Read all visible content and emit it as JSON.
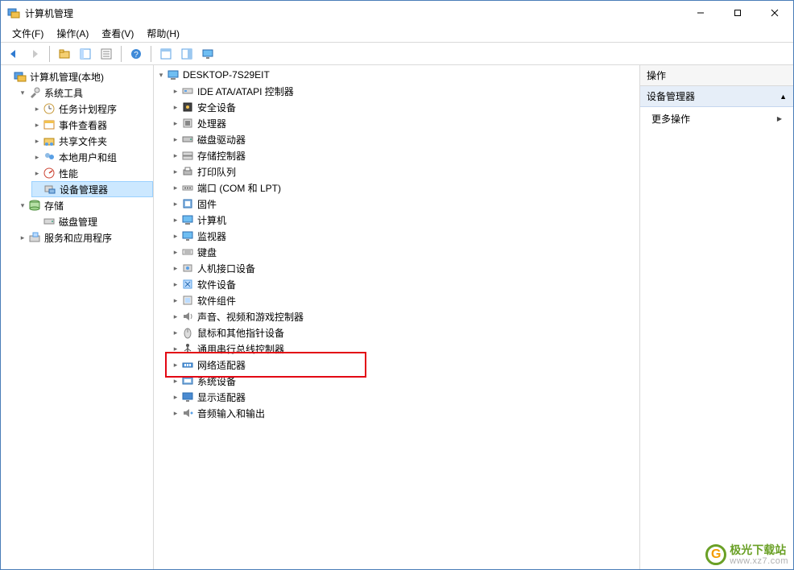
{
  "window": {
    "title": "计算机管理"
  },
  "menu": {
    "file": "文件(F)",
    "action": "操作(A)",
    "view": "查看(V)",
    "help": "帮助(H)"
  },
  "toolbar_icons": [
    "back",
    "forward",
    "up",
    "show-hide",
    "properties",
    "refresh",
    "help",
    "toggle-tree",
    "toggle-actions",
    "monitor"
  ],
  "left_tree": {
    "root": "计算机管理(本地)",
    "system_tools": {
      "label": "系统工具",
      "children": {
        "task_scheduler": "任务计划程序",
        "event_viewer": "事件查看器",
        "shared_folders": "共享文件夹",
        "local_users": "本地用户和组",
        "performance": "性能",
        "device_manager": "设备管理器"
      }
    },
    "storage": {
      "label": "存储",
      "disk_mgmt": "磁盘管理"
    },
    "services_apps": "服务和应用程序"
  },
  "device_tree": {
    "computer": "DESKTOP-7S29EIT",
    "items": [
      "IDE ATA/ATAPI 控制器",
      "安全设备",
      "处理器",
      "磁盘驱动器",
      "存储控制器",
      "打印队列",
      "端口 (COM 和 LPT)",
      "固件",
      "计算机",
      "监视器",
      "键盘",
      "人机接口设备",
      "软件设备",
      "软件组件",
      "声音、视频和游戏控制器",
      "鼠标和其他指针设备",
      "通用串行总线控制器",
      "网络适配器",
      "系统设备",
      "显示适配器",
      "音频输入和输出"
    ]
  },
  "device_icons": [
    "ide",
    "security",
    "cpu",
    "disk",
    "storage",
    "printer",
    "port",
    "firmware",
    "computer",
    "monitor",
    "keyboard",
    "hid",
    "software",
    "component",
    "audio",
    "mouse",
    "usb",
    "network",
    "system",
    "display",
    "audio-io"
  ],
  "highlight_index": 17,
  "actions": {
    "header": "操作",
    "section": "设备管理器",
    "more": "更多操作"
  },
  "watermark": {
    "brand": "极光下载站",
    "url": "www.xz7.com"
  }
}
